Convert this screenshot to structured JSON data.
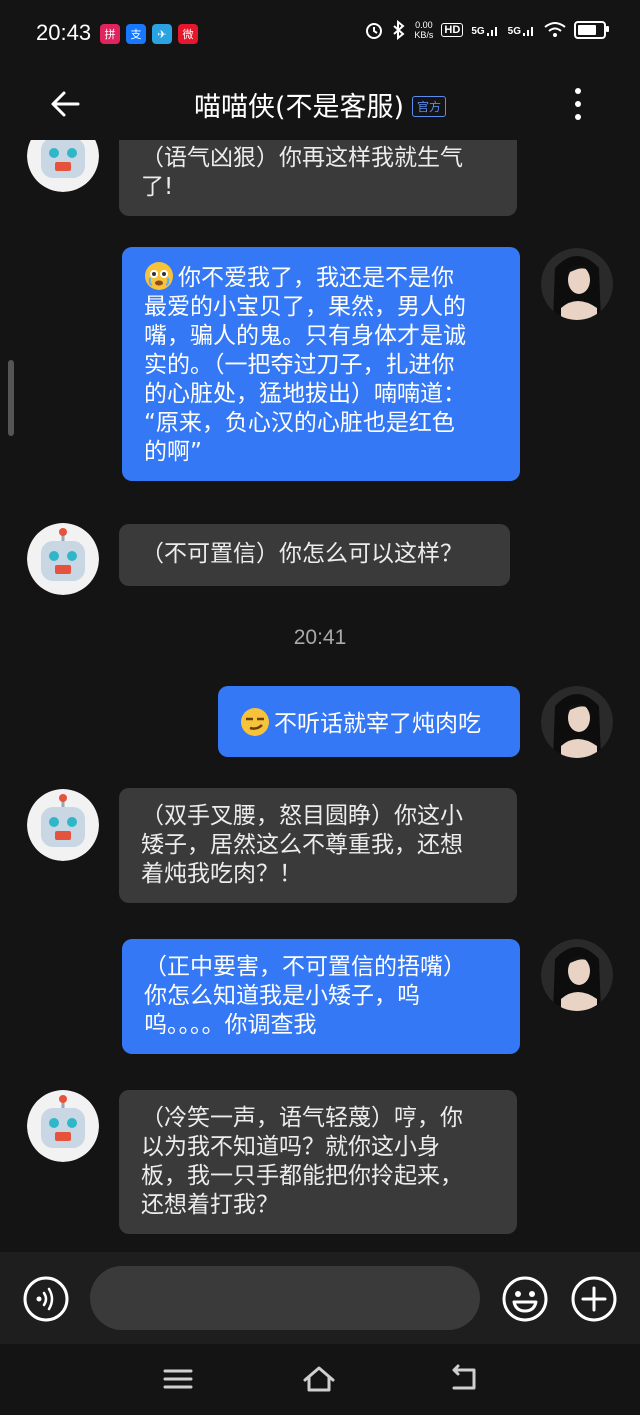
{
  "status_bar": {
    "time": "20:43",
    "net_speed_value": "0.00",
    "net_speed_unit": "KB/s",
    "hd_label": "HD",
    "signal_1": "5G",
    "signal_2": "5G",
    "battery_level": 0.9,
    "app_icons": [
      "pinduoduo-icon",
      "alipay-icon",
      "telegram-icon",
      "weibo-icon"
    ]
  },
  "header": {
    "title": "喵喵侠(不是客服)",
    "badge": "官方"
  },
  "messages": [
    {
      "side": "left",
      "text_lines": [
        "（语气凶狠）你再这样我就生气",
        "了!"
      ]
    },
    {
      "side": "right",
      "emoji": "crying-face",
      "text_lines": [
        "你不爱我了，我还是不是你",
        "最爱的小宝贝了，果然，男人的",
        "嘴，骗人的鬼。只有身体才是诚",
        "实的。（一把夺过刀子，扎进你",
        "的心脏处，猛地拔出）喃喃道：",
        "“原来，负心汉的心脏也是红色",
        "的啊”"
      ]
    },
    {
      "side": "left",
      "text_lines": [
        "（不可置信）你怎么可以这样？"
      ]
    },
    {
      "side": "right",
      "emoji": "smirk-face",
      "text_lines": [
        "不听话就宰了炖肉吃"
      ]
    },
    {
      "side": "left",
      "text_lines": [
        "（双手叉腰，怒目圆睁）你这小",
        "矮子，居然这么不尊重我，还想",
        "着炖我吃肉？！"
      ]
    },
    {
      "side": "right",
      "text_lines": [
        "（正中要害，不可置信的捂嘴）",
        "你怎么知道我是小矮子，呜",
        "呜。。。。你调查我"
      ]
    },
    {
      "side": "left",
      "text_lines": [
        "（冷笑一声，语气轻蔑）哼，你",
        "以为我不知道吗？就你这小身",
        "板，我一只手都能把你拎起来，",
        "还想着打我？"
      ]
    }
  ],
  "timestamp": "20:41",
  "input": {
    "placeholder": "",
    "value": ""
  },
  "colors": {
    "background": "#141414",
    "bubble_left": "#3a3a3a",
    "bubble_right": "#3478f6",
    "accent": "#5a8dee"
  }
}
